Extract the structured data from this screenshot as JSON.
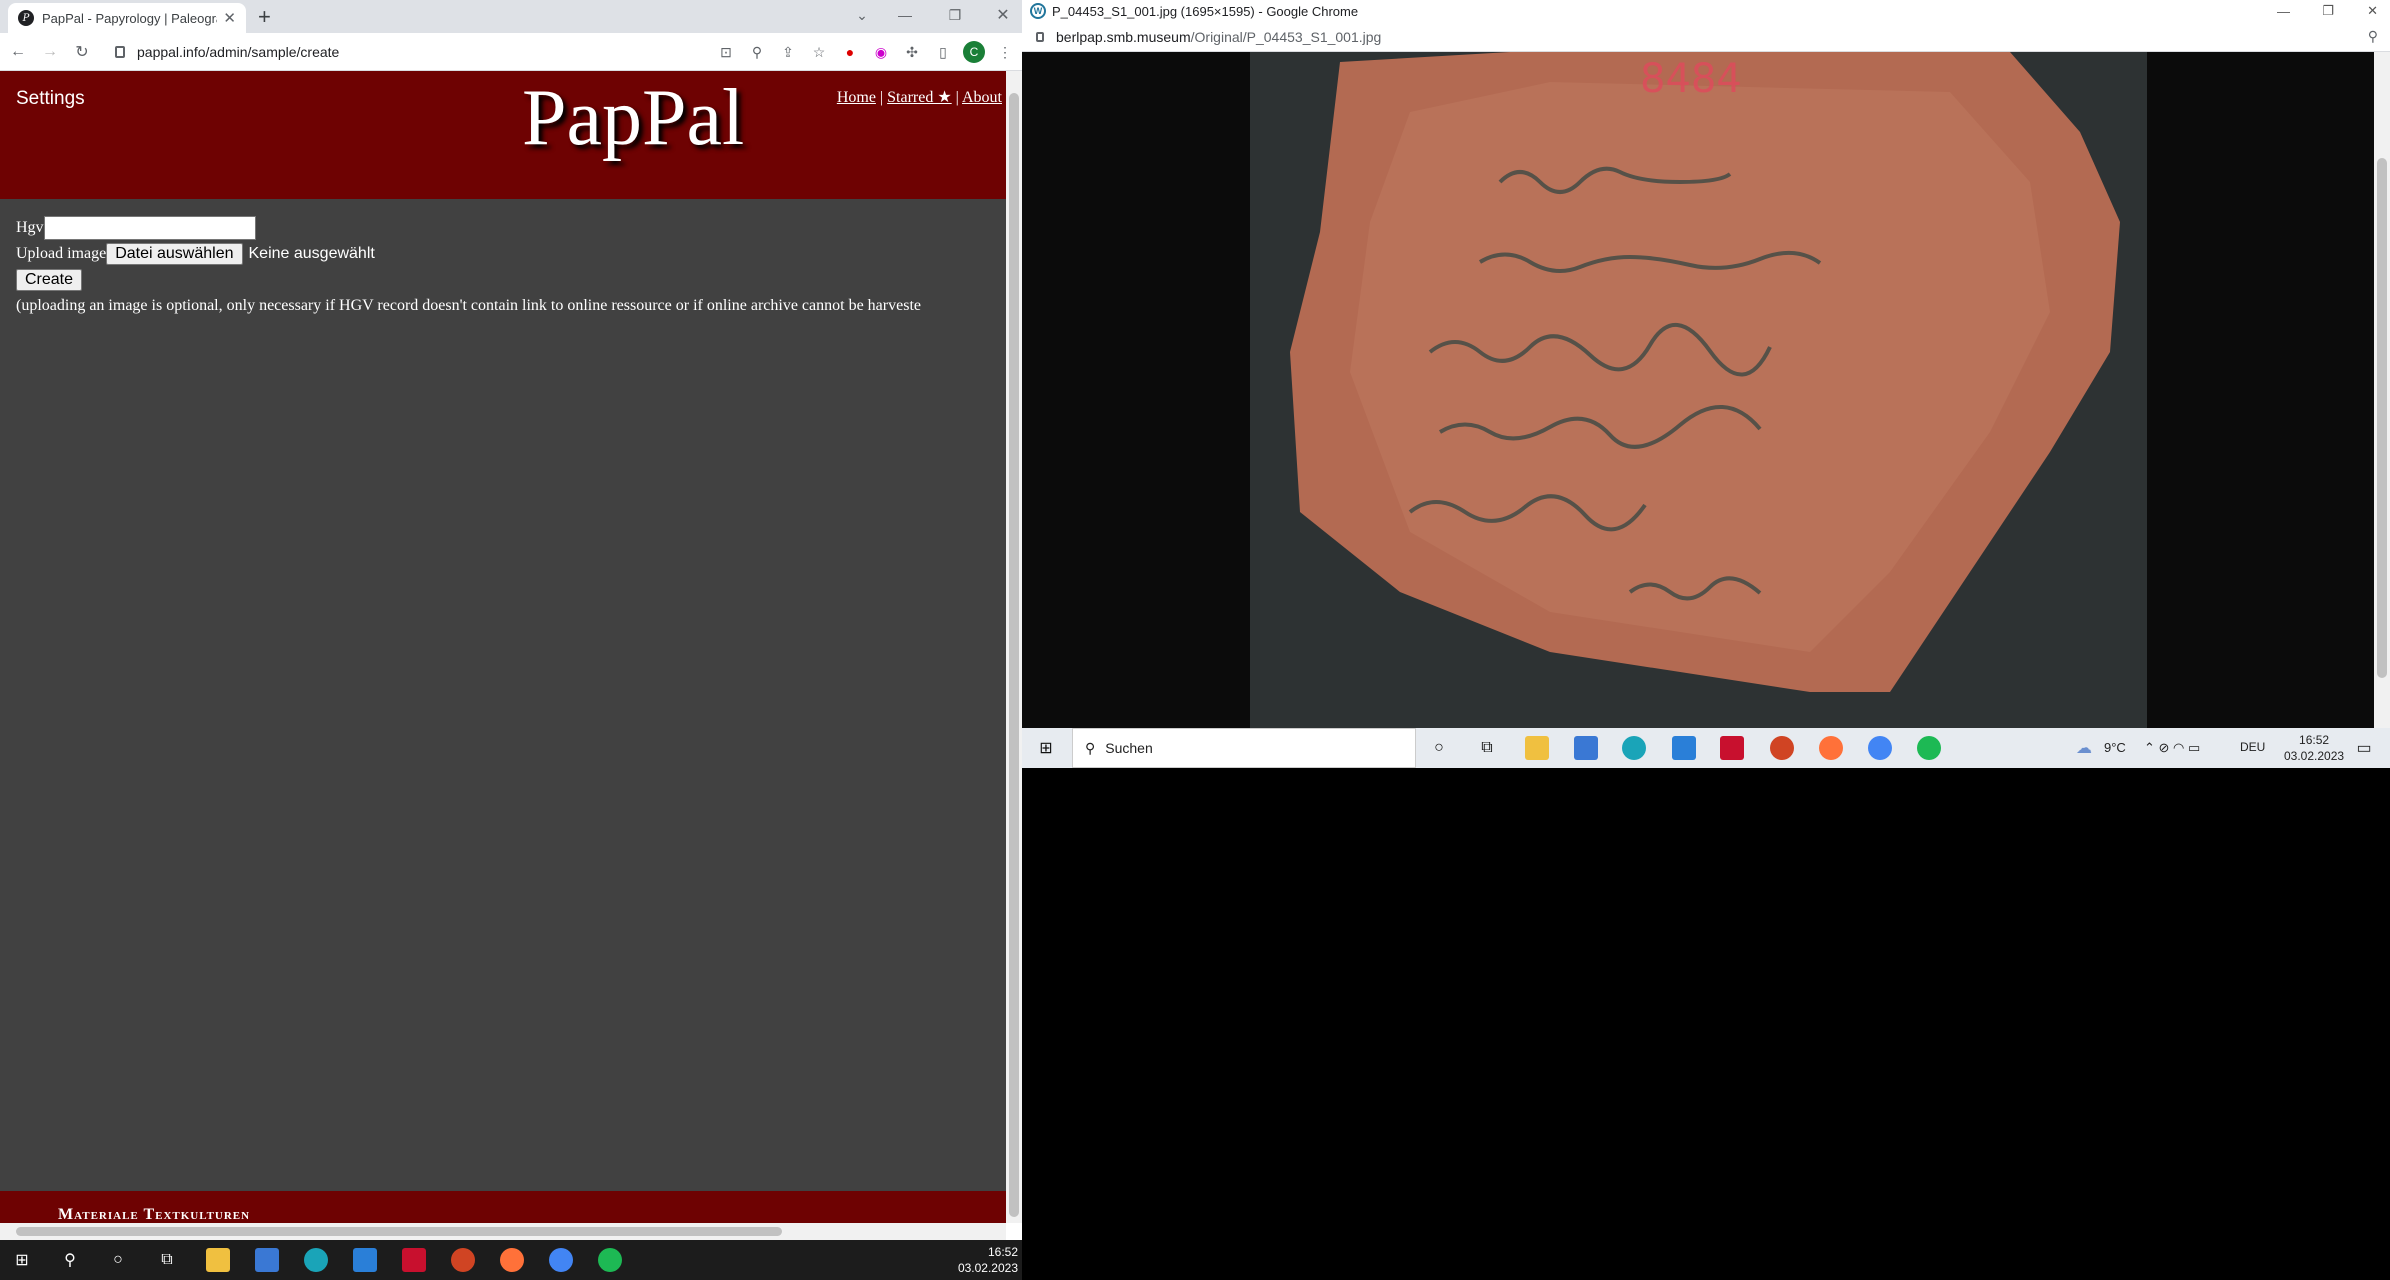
{
  "left_browser": {
    "tab_title": "PapPal - Papyrology | Paleograph",
    "url": "pappal.info/admin/sample/create",
    "profile_initial": "C"
  },
  "page": {
    "settings": "Settings",
    "logo": "PapPal",
    "nav": {
      "home": "Home",
      "starred": "Starred ★",
      "about": "About"
    },
    "form": {
      "hgv_label": "Hgv",
      "upload_label": "Upload image",
      "choose_file": "Datei auswählen",
      "no_file": "Keine ausgewählt",
      "create": "Create",
      "note": "(uploading an image is optional, only necessary if HGV record doesn't contain link to online ressource or if online archive cannot be harveste"
    },
    "footer": "Materiale Textkulturen"
  },
  "right_browser": {
    "title": "P_04453_S1_001.jpg (1695×1595) - Google Chrome",
    "url_domain": "berlpap.smb.museum",
    "url_path": "/Original/P_04453_S1_001.jpg"
  },
  "right_taskbar": {
    "search": "Suchen",
    "weather": "9°C",
    "lang": "DEU",
    "time": "16:52",
    "date": "03.02.2023"
  },
  "main_taskbar": {
    "time": "16:52",
    "date": "03.02.2023"
  },
  "colors": {
    "brand": "#6e0202",
    "page_bg": "#414141"
  }
}
